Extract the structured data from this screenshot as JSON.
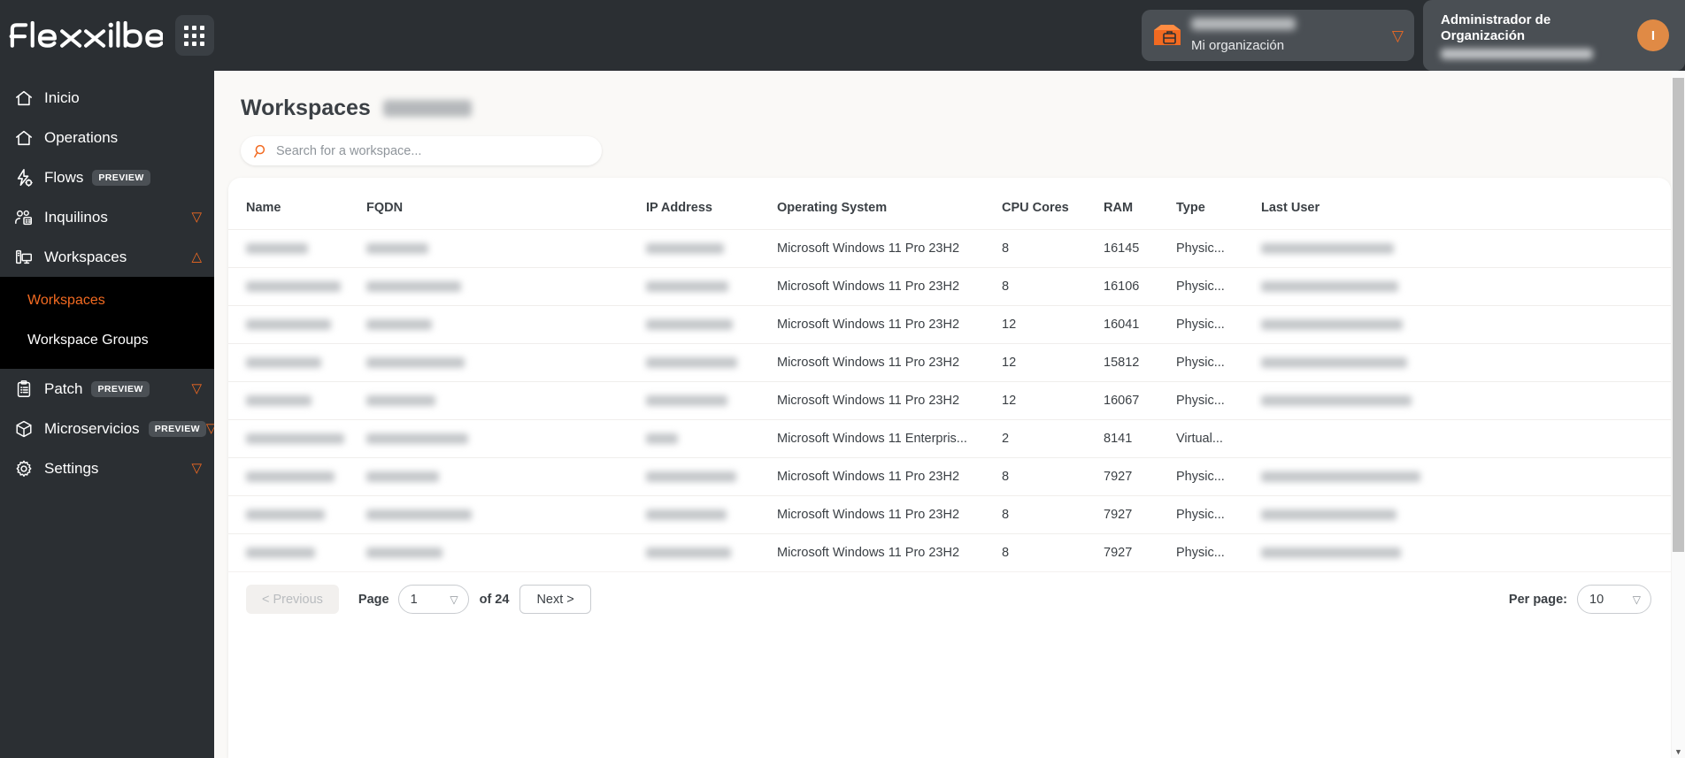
{
  "brand": {
    "name": "flexxible",
    "apps_icon": "grid-apps-icon"
  },
  "header": {
    "org": {
      "icon": "box-toolbox-icon",
      "name_redacted": true,
      "subtitle": "Mi organización",
      "chevron": "chevron-down-icon"
    },
    "user": {
      "role_line1": "Administrador de",
      "role_line2": "Organización",
      "name_redacted": true,
      "avatar_initial": "I",
      "avatar_color": "#e08a45"
    }
  },
  "sidebar": {
    "items": [
      {
        "label": "Inicio",
        "icon": "home-icon",
        "badge": null,
        "chevron": null,
        "expanded": false
      },
      {
        "label": "Operations",
        "icon": "home-icon",
        "badge": null,
        "chevron": null,
        "expanded": false
      },
      {
        "label": "Flows",
        "icon": "flow-bolt-icon",
        "badge": "PREVIEW",
        "chevron": null,
        "expanded": false
      },
      {
        "label": "Inquilinos",
        "icon": "users-building-icon",
        "badge": null,
        "chevron": "chevron-down-icon",
        "expanded": false
      },
      {
        "label": "Workspaces",
        "icon": "desktop-icon",
        "badge": null,
        "chevron": "chevron-up-icon",
        "expanded": true
      },
      {
        "label": "Patch",
        "icon": "clipboard-list-icon",
        "badge": "PREVIEW",
        "chevron": "chevron-down-icon",
        "expanded": false
      },
      {
        "label": "Microservicios",
        "icon": "cube-icon",
        "badge": "PREVIEW",
        "chevron": "chevron-down-icon",
        "expanded": false
      },
      {
        "label": "Settings",
        "icon": "gear-icon",
        "badge": null,
        "chevron": "chevron-down-icon",
        "expanded": false
      }
    ],
    "submenu": [
      {
        "label": "Workspaces",
        "active": true
      },
      {
        "label": "Workspace Groups",
        "active": false
      }
    ],
    "accent_color": "#f26a21"
  },
  "main": {
    "page_title": "Workspaces",
    "page_title_chip_redacted": true,
    "search": {
      "placeholder": "Search for a workspace...",
      "value": "",
      "icon": "search-icon"
    },
    "table": {
      "columns": [
        "Name",
        "FQDN",
        "IP Address",
        "Operating System",
        "CPU Cores",
        "RAM",
        "Type",
        "Last User"
      ],
      "rows": [
        {
          "name_redacted": true,
          "fqdn_redacted": true,
          "ip_redacted": true,
          "os": "Microsoft Windows 11 Pro 23H2",
          "cpu": "8",
          "ram": "16145",
          "type": "Physic...",
          "user_redacted": true
        },
        {
          "name_redacted": true,
          "fqdn_redacted": true,
          "ip_redacted": true,
          "os": "Microsoft Windows 11 Pro 23H2",
          "cpu": "8",
          "ram": "16106",
          "type": "Physic...",
          "user_redacted": true
        },
        {
          "name_redacted": true,
          "fqdn_redacted": true,
          "ip_redacted": true,
          "os": "Microsoft Windows 11 Pro 23H2",
          "cpu": "12",
          "ram": "16041",
          "type": "Physic...",
          "user_redacted": true
        },
        {
          "name_redacted": true,
          "fqdn_redacted": true,
          "ip_redacted": true,
          "os": "Microsoft Windows 11 Pro 23H2",
          "cpu": "12",
          "ram": "15812",
          "type": "Physic...",
          "user_redacted": true
        },
        {
          "name_redacted": true,
          "fqdn_redacted": true,
          "ip_redacted": true,
          "os": "Microsoft Windows 11 Pro 23H2",
          "cpu": "12",
          "ram": "16067",
          "type": "Physic...",
          "user_redacted": true
        },
        {
          "name_redacted": true,
          "fqdn_redacted": true,
          "ip_redacted": true,
          "os": "Microsoft Windows 11 Enterpris...",
          "cpu": "2",
          "ram": "8141",
          "type": "Virtual...",
          "user_redacted": false
        },
        {
          "name_redacted": true,
          "fqdn_redacted": true,
          "ip_redacted": true,
          "os": "Microsoft Windows 11 Pro 23H2",
          "cpu": "8",
          "ram": "7927",
          "type": "Physic...",
          "user_redacted": true
        },
        {
          "name_redacted": true,
          "fqdn_redacted": true,
          "ip_redacted": true,
          "os": "Microsoft Windows 11 Pro 23H2",
          "cpu": "8",
          "ram": "7927",
          "type": "Physic...",
          "user_redacted": true
        },
        {
          "name_redacted": true,
          "fqdn_redacted": true,
          "ip_redacted": true,
          "os": "Microsoft Windows 11 Pro 23H2",
          "cpu": "8",
          "ram": "7927",
          "type": "Physic...",
          "user_redacted": true
        }
      ]
    },
    "pagination": {
      "previous_label": "< Previous",
      "previous_disabled": true,
      "page_label": "Page",
      "page_value": "1",
      "of_label": "of 24",
      "total_pages": 24,
      "next_label": "Next >",
      "per_page_label": "Per page:",
      "per_page_value": "10"
    }
  }
}
